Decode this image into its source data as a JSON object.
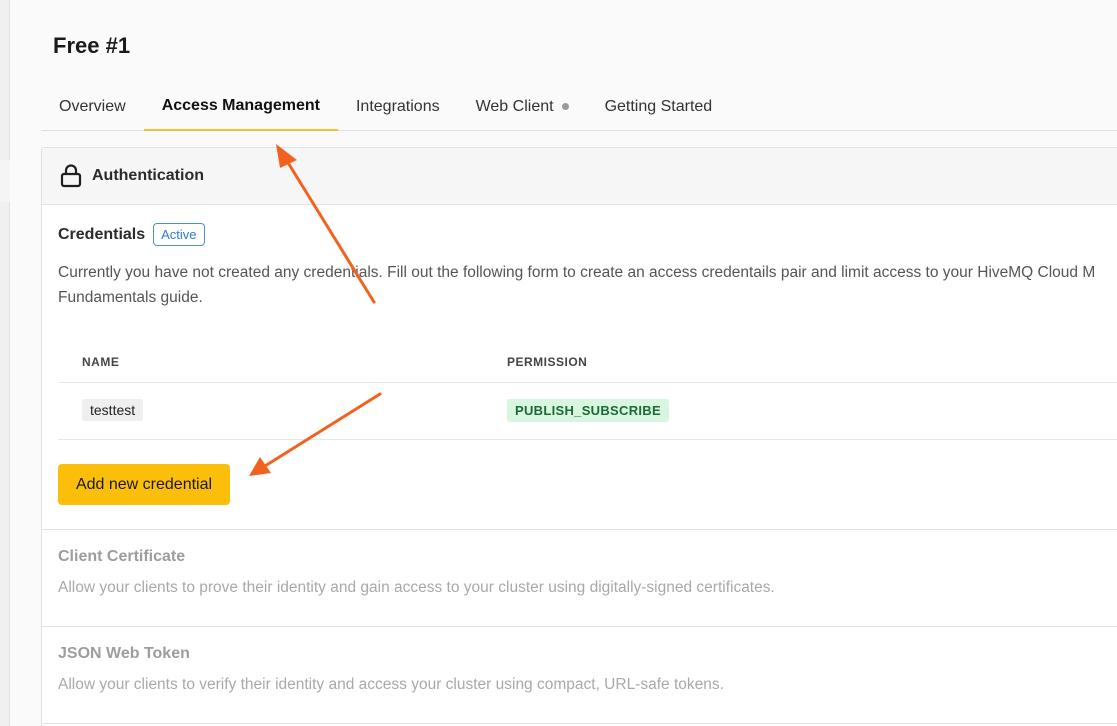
{
  "header": {
    "title": "Free #1"
  },
  "tabs": [
    {
      "label": "Overview",
      "active": false
    },
    {
      "label": "Access Management",
      "active": true
    },
    {
      "label": "Integrations",
      "active": false
    },
    {
      "label": "Web Client",
      "active": false,
      "indicator": "status-dot"
    },
    {
      "label": "Getting Started",
      "active": false
    }
  ],
  "auth": {
    "title": "Authentication",
    "icon": "lock-icon",
    "credentials": {
      "title": "Credentials",
      "status": "Active",
      "description_line1": "Currently you have not created any credentials. Fill out the following form to create an access credentails pair and limit access to your HiveMQ Cloud M",
      "description_line2": "Fundamentals guide.",
      "table": {
        "columns": [
          "NAME",
          "PERMISSION"
        ],
        "rows": [
          {
            "name": "testtest",
            "permission": "PUBLISH_SUBSCRIBE"
          }
        ]
      },
      "add_button": "Add new credential"
    },
    "client_certificate": {
      "title": "Client Certificate",
      "description": "Allow your clients to prove their identity and gain access to your cluster using digitally-signed certificates."
    },
    "jwt": {
      "title": "JSON Web Token",
      "description": "Allow your clients to verify their identity and access your cluster using compact, URL-safe tokens."
    }
  },
  "colors": {
    "accent": "#fbbf0b",
    "tab_underline": "#f2c031",
    "badge_blue": "#2a7bd6",
    "permission_bg": "#d8f5df",
    "annotation_arrow": "#f2621f"
  }
}
